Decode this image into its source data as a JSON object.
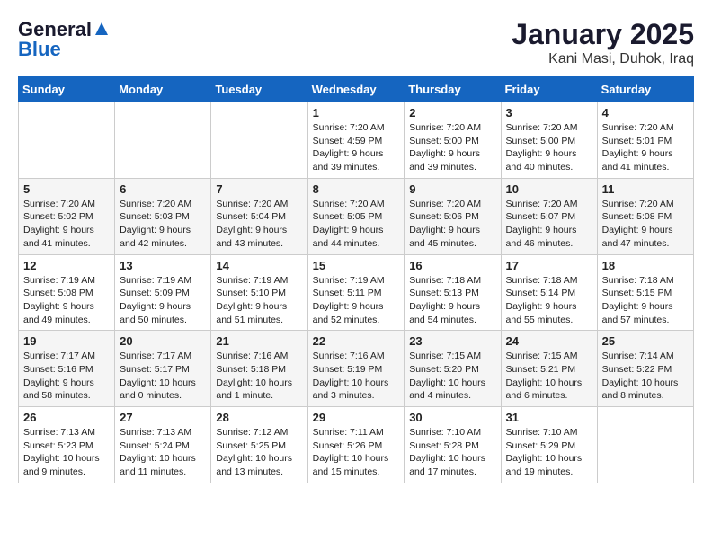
{
  "header": {
    "logo_general": "General",
    "logo_blue": "Blue",
    "title": "January 2025",
    "subtitle": "Kani Masi, Duhok, Iraq"
  },
  "weekdays": [
    "Sunday",
    "Monday",
    "Tuesday",
    "Wednesday",
    "Thursday",
    "Friday",
    "Saturday"
  ],
  "weeks": [
    [
      {
        "day": "",
        "info": ""
      },
      {
        "day": "",
        "info": ""
      },
      {
        "day": "",
        "info": ""
      },
      {
        "day": "1",
        "info": "Sunrise: 7:20 AM\nSunset: 4:59 PM\nDaylight: 9 hours\nand 39 minutes."
      },
      {
        "day": "2",
        "info": "Sunrise: 7:20 AM\nSunset: 5:00 PM\nDaylight: 9 hours\nand 39 minutes."
      },
      {
        "day": "3",
        "info": "Sunrise: 7:20 AM\nSunset: 5:00 PM\nDaylight: 9 hours\nand 40 minutes."
      },
      {
        "day": "4",
        "info": "Sunrise: 7:20 AM\nSunset: 5:01 PM\nDaylight: 9 hours\nand 41 minutes."
      }
    ],
    [
      {
        "day": "5",
        "info": "Sunrise: 7:20 AM\nSunset: 5:02 PM\nDaylight: 9 hours\nand 41 minutes."
      },
      {
        "day": "6",
        "info": "Sunrise: 7:20 AM\nSunset: 5:03 PM\nDaylight: 9 hours\nand 42 minutes."
      },
      {
        "day": "7",
        "info": "Sunrise: 7:20 AM\nSunset: 5:04 PM\nDaylight: 9 hours\nand 43 minutes."
      },
      {
        "day": "8",
        "info": "Sunrise: 7:20 AM\nSunset: 5:05 PM\nDaylight: 9 hours\nand 44 minutes."
      },
      {
        "day": "9",
        "info": "Sunrise: 7:20 AM\nSunset: 5:06 PM\nDaylight: 9 hours\nand 45 minutes."
      },
      {
        "day": "10",
        "info": "Sunrise: 7:20 AM\nSunset: 5:07 PM\nDaylight: 9 hours\nand 46 minutes."
      },
      {
        "day": "11",
        "info": "Sunrise: 7:20 AM\nSunset: 5:08 PM\nDaylight: 9 hours\nand 47 minutes."
      }
    ],
    [
      {
        "day": "12",
        "info": "Sunrise: 7:19 AM\nSunset: 5:08 PM\nDaylight: 9 hours\nand 49 minutes."
      },
      {
        "day": "13",
        "info": "Sunrise: 7:19 AM\nSunset: 5:09 PM\nDaylight: 9 hours\nand 50 minutes."
      },
      {
        "day": "14",
        "info": "Sunrise: 7:19 AM\nSunset: 5:10 PM\nDaylight: 9 hours\nand 51 minutes."
      },
      {
        "day": "15",
        "info": "Sunrise: 7:19 AM\nSunset: 5:11 PM\nDaylight: 9 hours\nand 52 minutes."
      },
      {
        "day": "16",
        "info": "Sunrise: 7:18 AM\nSunset: 5:13 PM\nDaylight: 9 hours\nand 54 minutes."
      },
      {
        "day": "17",
        "info": "Sunrise: 7:18 AM\nSunset: 5:14 PM\nDaylight: 9 hours\nand 55 minutes."
      },
      {
        "day": "18",
        "info": "Sunrise: 7:18 AM\nSunset: 5:15 PM\nDaylight: 9 hours\nand 57 minutes."
      }
    ],
    [
      {
        "day": "19",
        "info": "Sunrise: 7:17 AM\nSunset: 5:16 PM\nDaylight: 9 hours\nand 58 minutes."
      },
      {
        "day": "20",
        "info": "Sunrise: 7:17 AM\nSunset: 5:17 PM\nDaylight: 10 hours\nand 0 minutes."
      },
      {
        "day": "21",
        "info": "Sunrise: 7:16 AM\nSunset: 5:18 PM\nDaylight: 10 hours\nand 1 minute."
      },
      {
        "day": "22",
        "info": "Sunrise: 7:16 AM\nSunset: 5:19 PM\nDaylight: 10 hours\nand 3 minutes."
      },
      {
        "day": "23",
        "info": "Sunrise: 7:15 AM\nSunset: 5:20 PM\nDaylight: 10 hours\nand 4 minutes."
      },
      {
        "day": "24",
        "info": "Sunrise: 7:15 AM\nSunset: 5:21 PM\nDaylight: 10 hours\nand 6 minutes."
      },
      {
        "day": "25",
        "info": "Sunrise: 7:14 AM\nSunset: 5:22 PM\nDaylight: 10 hours\nand 8 minutes."
      }
    ],
    [
      {
        "day": "26",
        "info": "Sunrise: 7:13 AM\nSunset: 5:23 PM\nDaylight: 10 hours\nand 9 minutes."
      },
      {
        "day": "27",
        "info": "Sunrise: 7:13 AM\nSunset: 5:24 PM\nDaylight: 10 hours\nand 11 minutes."
      },
      {
        "day": "28",
        "info": "Sunrise: 7:12 AM\nSunset: 5:25 PM\nDaylight: 10 hours\nand 13 minutes."
      },
      {
        "day": "29",
        "info": "Sunrise: 7:11 AM\nSunset: 5:26 PM\nDaylight: 10 hours\nand 15 minutes."
      },
      {
        "day": "30",
        "info": "Sunrise: 7:10 AM\nSunset: 5:28 PM\nDaylight: 10 hours\nand 17 minutes."
      },
      {
        "day": "31",
        "info": "Sunrise: 7:10 AM\nSunset: 5:29 PM\nDaylight: 10 hours\nand 19 minutes."
      },
      {
        "day": "",
        "info": ""
      }
    ]
  ]
}
